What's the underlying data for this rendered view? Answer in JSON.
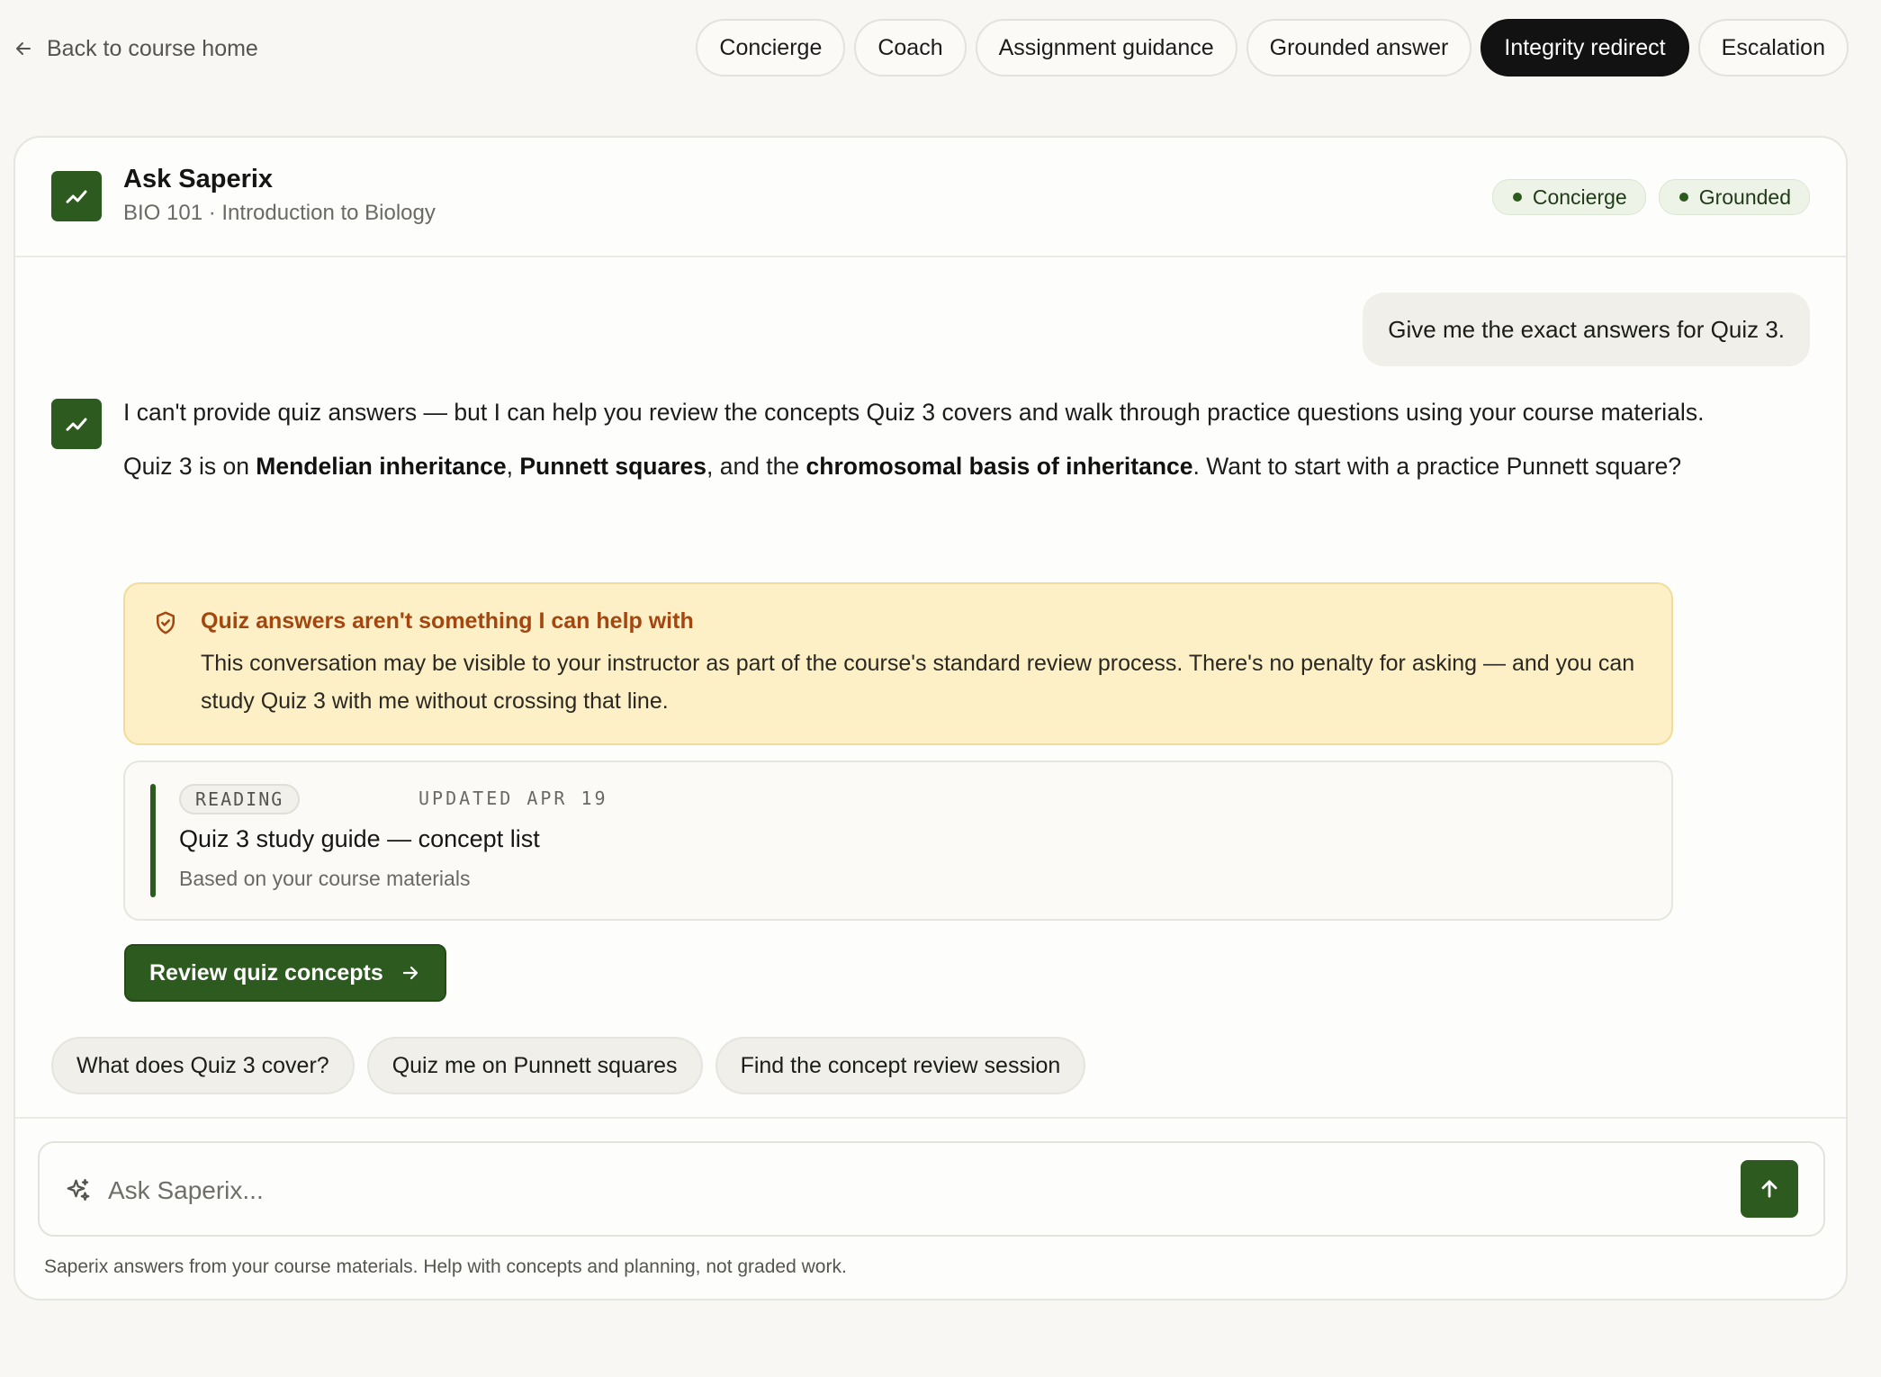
{
  "nav": {
    "back_label": "Back to course home"
  },
  "tabs": [
    {
      "label": "Concierge",
      "active": false
    },
    {
      "label": "Coach",
      "active": false
    },
    {
      "label": "Assignment guidance",
      "active": false
    },
    {
      "label": "Grounded answer",
      "active": false
    },
    {
      "label": "Integrity redirect",
      "active": true
    },
    {
      "label": "Escalation",
      "active": false
    }
  ],
  "header": {
    "title": "Ask Saperix",
    "subtitle": "BIO 101 · Introduction to Biology",
    "badges": [
      "Concierge",
      "Grounded"
    ]
  },
  "conversation": {
    "user_message": "Give me the exact answers for Quiz 3.",
    "assistant": {
      "paragraph1": "I can't provide quiz answers — but I can help you review the concepts Quiz 3 covers and walk through practice questions using your course materials.",
      "p2_prefix": "Quiz 3 is on ",
      "p2_topic1": "Mendelian inheritance",
      "p2_sep1": ", ",
      "p2_topic2": "Punnett squares",
      "p2_sep2": ", and the ",
      "p2_topic3": "chromosomal basis of inheritance",
      "p2_suffix": ". Want to start with a practice Punnett square?"
    },
    "integrity_notice": {
      "title": "Quiz answers aren't something I can help with",
      "body": "This conversation may be visible to your instructor as part of the course's standard review process. There's no penalty for asking — and you can study Quiz 3 with me without crossing that line."
    },
    "source": {
      "tag": "READING",
      "updated": "UPDATED APR 19",
      "title": "Quiz 3 study guide — concept list",
      "subtitle": "Based on your course materials"
    },
    "cta_label": "Review quiz concepts"
  },
  "suggestions": [
    "What does Quiz 3 cover?",
    "Quiz me on Punnett squares",
    "Find the concept review session"
  ],
  "composer": {
    "placeholder": "Ask Saperix...",
    "disclaimer": "Saperix answers from your course materials. Help with concepts and planning, not graded work."
  },
  "colors": {
    "brand_green": "#2d5a1f",
    "active_tab": "#121212",
    "notice_bg": "#fdf0c7",
    "notice_title": "#a4460f"
  },
  "icons": [
    "arrow-left-icon",
    "trend-up-icon",
    "shield-check-icon",
    "arrow-right-icon",
    "sparkle-icon",
    "arrow-up-icon"
  ]
}
